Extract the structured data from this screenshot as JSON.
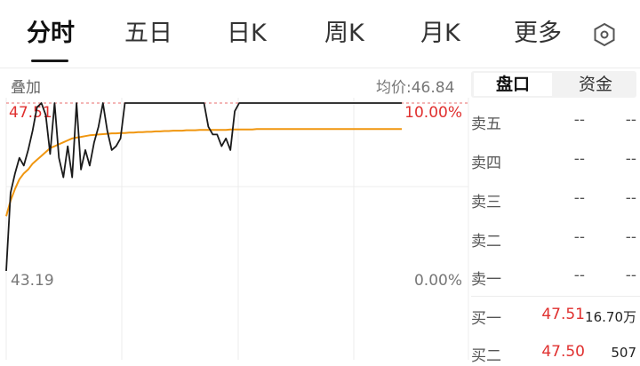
{
  "tabs": [
    {
      "label": "分时",
      "active": true
    },
    {
      "label": "五日",
      "active": false
    },
    {
      "label": "日K",
      "active": false
    },
    {
      "label": "周K",
      "active": false
    },
    {
      "label": "月K",
      "active": false
    },
    {
      "label": "更多",
      "active": false
    }
  ],
  "settings_icon": "hexagon-gear-icon",
  "chart_header": {
    "overlay_label": "叠加",
    "avg_price_text": "均价:46.84"
  },
  "chart": {
    "price_high": "47.51",
    "price_low": "43.19",
    "pct_high": "10.00%",
    "pct_low": "0.00%",
    "colors": {
      "price_line": "#1a1a1a",
      "avg_line": "#f0960f",
      "up": "#e0302f",
      "grid": "#ececec"
    }
  },
  "chart_data": {
    "type": "line",
    "ylim": [
      43.19,
      47.51
    ],
    "grid": true,
    "series": [
      {
        "values": [
          43.19,
          45.2,
          45.7,
          46.1,
          45.9,
          46.3,
          46.8,
          47.4,
          47.51,
          47.2,
          46.2,
          47.51,
          46.1,
          45.6,
          46.4,
          45.6,
          47.51,
          45.8,
          46.3,
          45.9,
          46.5,
          46.9,
          47.51,
          46.8,
          46.3,
          46.4,
          46.6,
          47.51,
          47.51,
          47.51,
          47.51,
          47.51,
          47.51,
          47.51,
          47.51,
          47.51,
          47.51,
          47.51,
          47.51,
          47.51,
          47.51,
          47.51,
          47.51,
          47.51,
          47.51,
          47.51,
          46.9,
          46.7,
          46.7,
          46.4,
          46.6,
          46.3,
          47.3,
          47.51,
          47.51,
          47.51,
          47.51,
          47.51,
          47.51,
          47.51,
          47.51,
          47.51,
          47.51,
          47.51,
          47.51,
          47.51,
          47.51,
          47.51,
          47.51,
          47.51,
          47.51,
          47.51,
          47.51,
          47.51,
          47.51,
          47.51,
          47.51,
          47.51,
          47.51,
          47.51,
          47.51,
          47.51,
          47.51,
          47.51,
          47.51,
          47.51,
          47.51,
          47.51,
          47.51,
          47.51,
          47.51
        ]
      },
      {
        "values": [
          44.6,
          45.0,
          45.3,
          45.55,
          45.7,
          45.8,
          45.95,
          46.05,
          46.15,
          46.25,
          46.35,
          46.4,
          46.45,
          46.5,
          46.55,
          46.6,
          46.62,
          46.64,
          46.66,
          46.68,
          46.69,
          46.7,
          46.71,
          46.72,
          46.73,
          46.73,
          46.74,
          46.74,
          46.75,
          46.75,
          46.76,
          46.76,
          46.77,
          46.77,
          46.78,
          46.78,
          46.79,
          46.79,
          46.8,
          46.8,
          46.8,
          46.81,
          46.81,
          46.81,
          46.82,
          46.82,
          46.82,
          46.82,
          46.82,
          46.82,
          46.82,
          46.83,
          46.83,
          46.83,
          46.83,
          46.83,
          46.83,
          46.84,
          46.84,
          46.84,
          46.84,
          46.84,
          46.84,
          46.84,
          46.84,
          46.84,
          46.84,
          46.84,
          46.84,
          46.84,
          46.84,
          46.84,
          46.84,
          46.84,
          46.84,
          46.84,
          46.84,
          46.84,
          46.84,
          46.84,
          46.84,
          46.84,
          46.84,
          46.84,
          46.84,
          46.84,
          46.84,
          46.84,
          46.84,
          46.84,
          46.84
        ]
      }
    ]
  },
  "order_book": {
    "tabs": [
      {
        "label": "盘口",
        "active": true
      },
      {
        "label": "资金",
        "active": false
      }
    ],
    "asks": [
      {
        "label": "卖五",
        "price": "--",
        "volume": "--"
      },
      {
        "label": "卖四",
        "price": "--",
        "volume": "--"
      },
      {
        "label": "卖三",
        "price": "--",
        "volume": "--"
      },
      {
        "label": "卖二",
        "price": "--",
        "volume": "--"
      },
      {
        "label": "卖一",
        "price": "--",
        "volume": "--"
      }
    ],
    "bids": [
      {
        "label": "买一",
        "price": "47.51",
        "volume": "16.70万"
      },
      {
        "label": "买二",
        "price": "47.50",
        "volume": "507"
      }
    ]
  }
}
